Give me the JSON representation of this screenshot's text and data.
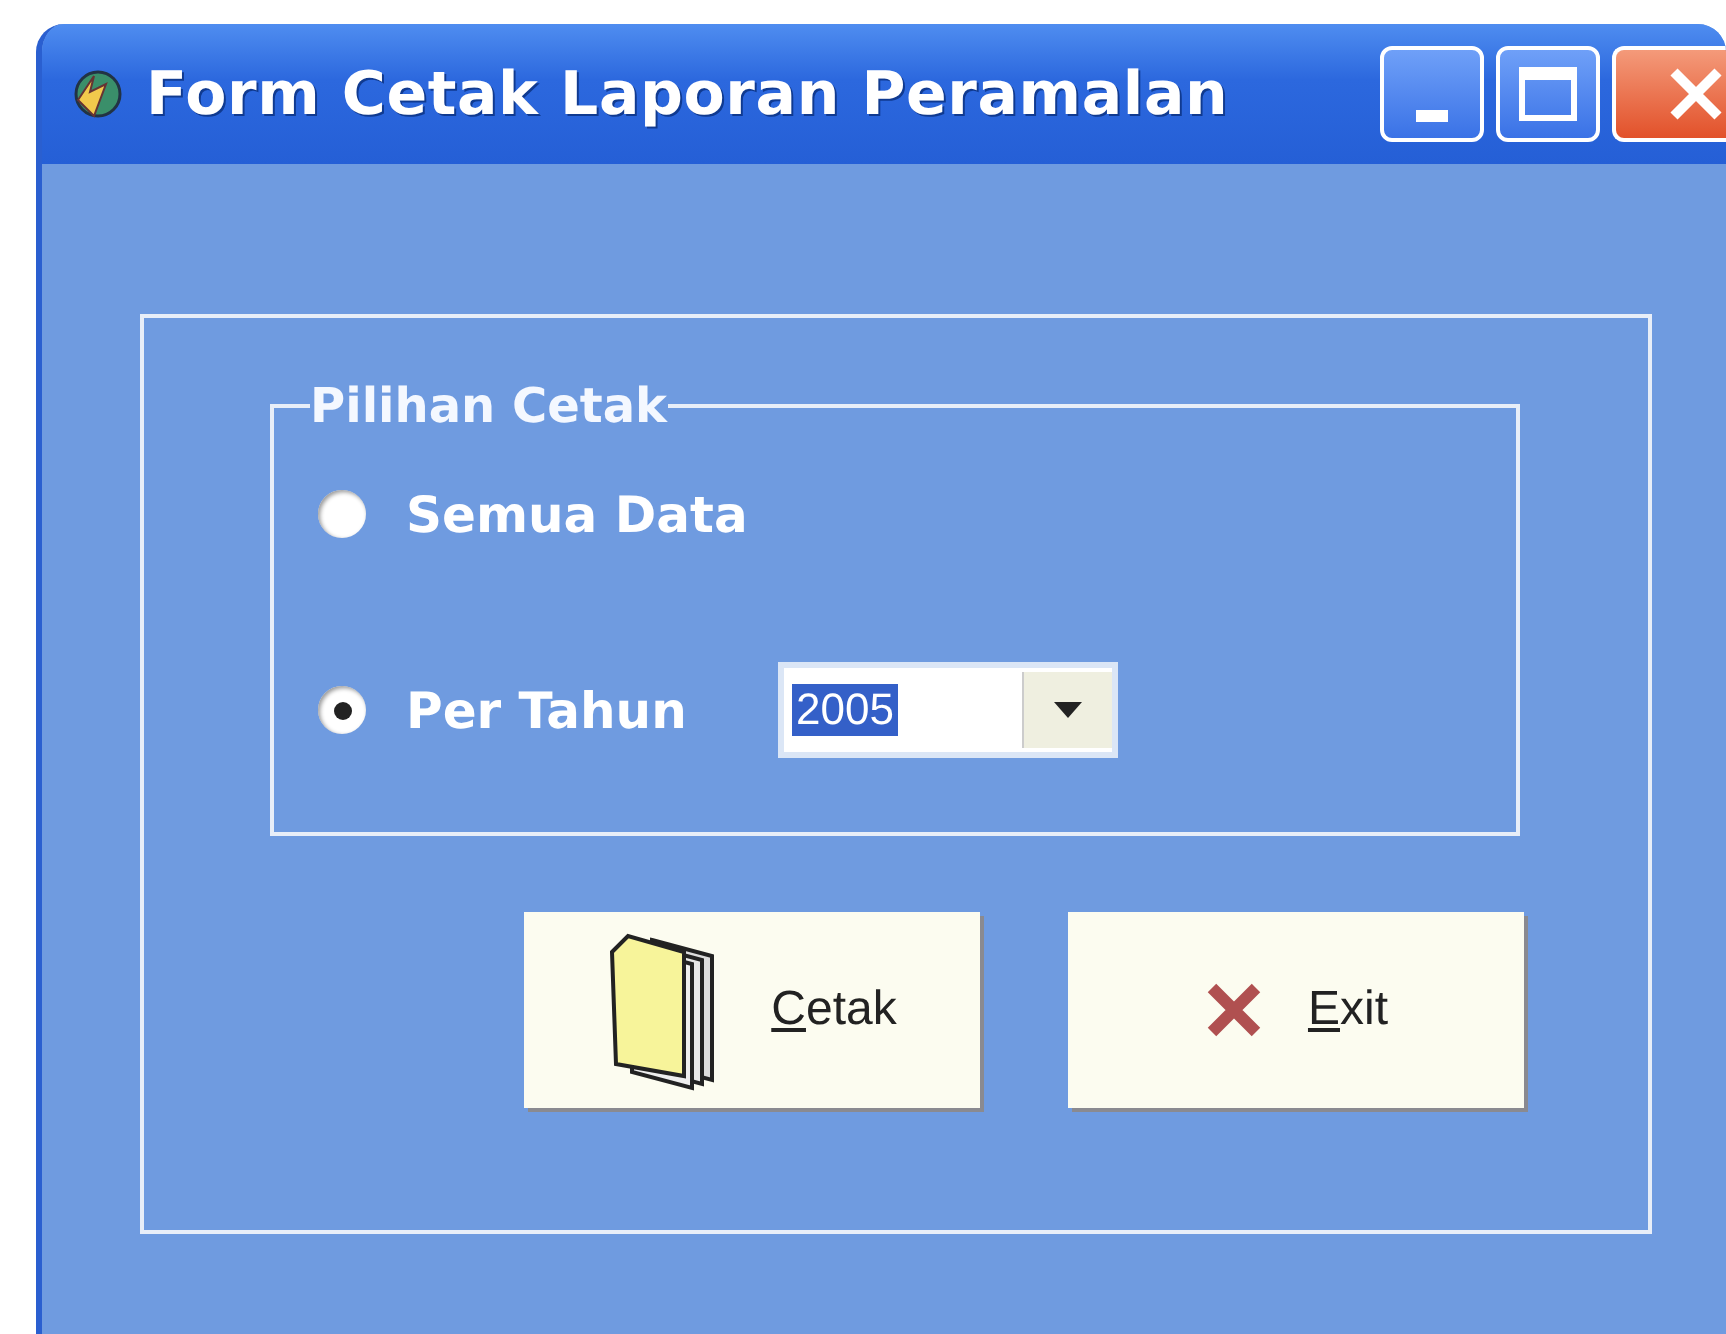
{
  "window": {
    "title": "Form Cetak Laporan Peramalan"
  },
  "print_options": {
    "legend": "Pilihan Cetak",
    "options": [
      {
        "kind": "plain",
        "label": "Semua Data",
        "selected": false
      },
      {
        "kind": "with_year",
        "label": "Per Tahun",
        "selected": true,
        "year": "2005"
      }
    ]
  },
  "buttons": [
    {
      "kind": "print",
      "label": "Cetak"
    },
    {
      "kind": "exit",
      "label": "Exit"
    }
  ]
}
